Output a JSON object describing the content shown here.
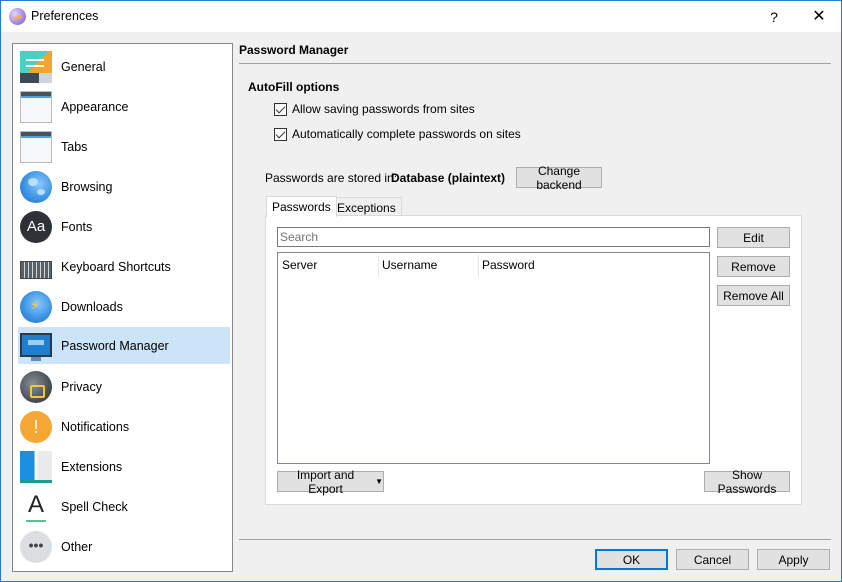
{
  "window": {
    "title": "Preferences",
    "help_label": "?",
    "close_label": "✕"
  },
  "sidebar": {
    "selected": "Password Manager",
    "items": [
      {
        "label": "General",
        "icon": "general-icon"
      },
      {
        "label": "Appearance",
        "icon": "appearance-icon"
      },
      {
        "label": "Tabs",
        "icon": "tabs-icon"
      },
      {
        "label": "Browsing",
        "icon": "globe-icon"
      },
      {
        "label": "Fonts",
        "icon": "fonts-icon",
        "glyph": "Aa"
      },
      {
        "label": "Keyboard Shortcuts",
        "icon": "keyboard-icon"
      },
      {
        "label": "Downloads",
        "icon": "downloads-icon"
      },
      {
        "label": "Password Manager",
        "icon": "monitor-icon"
      },
      {
        "label": "Privacy",
        "icon": "lock-icon"
      },
      {
        "label": "Notifications",
        "icon": "alert-icon",
        "glyph": "!"
      },
      {
        "label": "Extensions",
        "icon": "extensions-icon"
      },
      {
        "label": "Spell Check",
        "icon": "spellcheck-icon",
        "glyph": "A"
      },
      {
        "label": "Other",
        "icon": "more-icon",
        "glyph": "•••"
      }
    ]
  },
  "content": {
    "title": "Password Manager",
    "autofill": {
      "heading": "AutoFill options",
      "options": [
        {
          "label": "Allow saving passwords from sites",
          "checked": true
        },
        {
          "label": "Automatically complete passwords on sites",
          "checked": true
        }
      ]
    },
    "storage": {
      "label": "Passwords are stored in:",
      "value": "Database (plaintext)",
      "change_button": "Change backend"
    },
    "tabs": [
      {
        "label": "Passwords",
        "active": true
      },
      {
        "label": "Exceptions",
        "active": false
      }
    ],
    "search": {
      "placeholder": "Search",
      "value": ""
    },
    "table": {
      "columns": [
        "Server",
        "Username",
        "Password"
      ],
      "rows": []
    },
    "side_buttons": {
      "edit": "Edit",
      "remove": "Remove",
      "remove_all": "Remove All"
    },
    "import_export_button": "Import and Export",
    "show_passwords_button": "Show Passwords"
  },
  "footer": {
    "ok": "OK",
    "cancel": "Cancel",
    "apply": "Apply"
  },
  "colors": {
    "accent": "#0078d7",
    "selection": "#cce4f7",
    "window_border": "#2b79d0"
  }
}
